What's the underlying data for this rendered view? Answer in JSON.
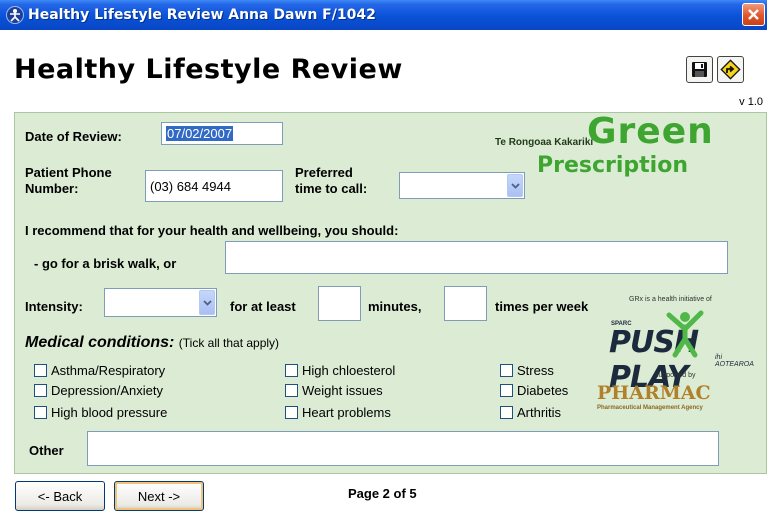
{
  "window": {
    "title": "Healthy Lifestyle Review Anna Dawn F/1042",
    "close_label": "×"
  },
  "header": {
    "heading": "Healthy Lifestyle Review",
    "version": "v 1.0",
    "save_icon": "floppy-disk-icon",
    "nav_icon": "road-sign-icon"
  },
  "form": {
    "date_label": "Date of Review:",
    "date_value": "07/02/2007",
    "phone_label_1": "Patient Phone",
    "phone_label_2": "Number:",
    "phone_value": "(03) 684 4944",
    "pref_label_1": "Preferred",
    "pref_label_2": "time to call:",
    "pref_value": "",
    "recommend": "I recommend that for your health and wellbeing, you should:",
    "walk_label": "- go for a brisk walk, or",
    "walk_value": "",
    "intensity_label": "Intensity:",
    "intensity_value": "",
    "atleast_label": "for at least",
    "minutes_value": "",
    "minutes_label": "minutes,",
    "times_value": "",
    "times_label": "times per week",
    "medical_title": "Medical conditions:",
    "medical_hint": "(Tick all that apply)",
    "conditions": [
      "Asthma/Respiratory",
      "Depression/Anxiety",
      "High blood pressure",
      "High chloesterol",
      "Weight issues",
      "Heart problems",
      "Stress",
      "Diabetes",
      "Arthritis"
    ],
    "other_label": "Other",
    "other_value": ""
  },
  "logos": {
    "org": "Te Rongoaa Kakariki",
    "green": "Green",
    "prescription": "Prescription",
    "grx_note": "GRx is a health initiative of",
    "sparc": "SPARC",
    "pushplay": "PUSH PLAY",
    "pushplay_sub": "ihi AOTEAROA",
    "supported": "supported by",
    "pharmac": "PHARMAC",
    "pharmac_sub": "Pharmaceutical Management Agency"
  },
  "footer": {
    "back_label": "<- Back",
    "next_label": "Next ->",
    "page_indicator": "Page 2 of 5"
  },
  "colors": {
    "panel": "#dcebd4",
    "brand_green": "#3ea531",
    "titlebar": "#0a52d8"
  }
}
